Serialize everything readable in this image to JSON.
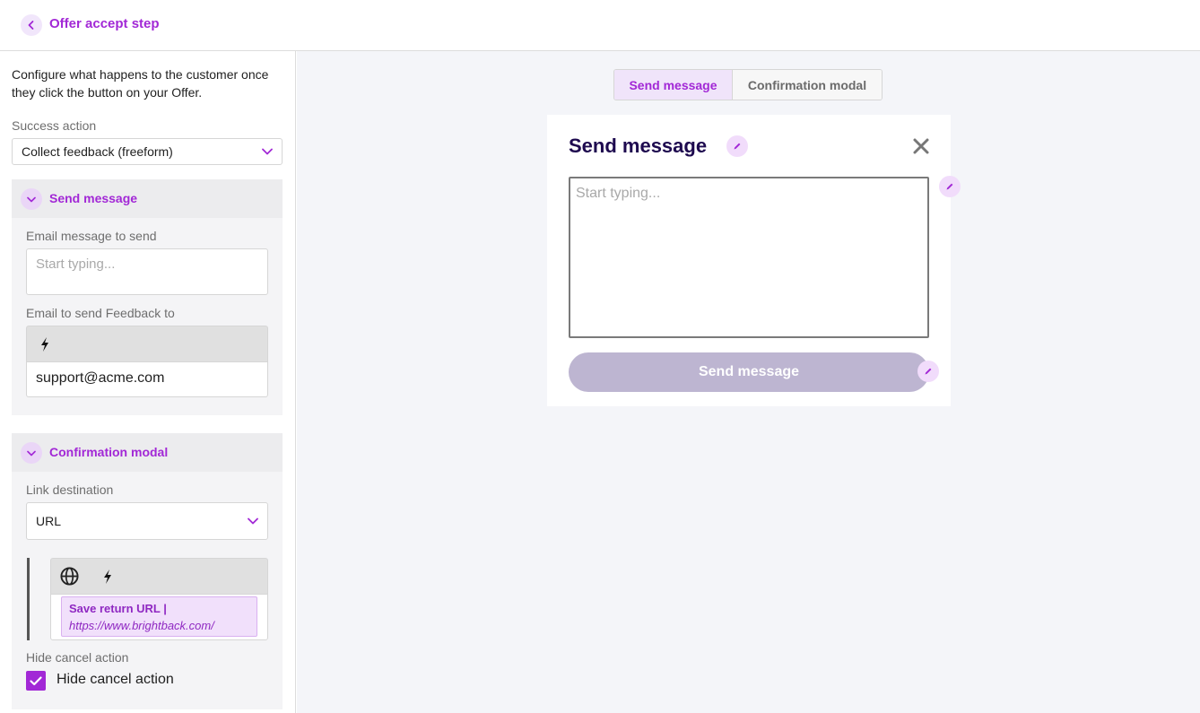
{
  "header": {
    "title": "Offer accept step"
  },
  "left": {
    "intro": "Configure what happens to the customer once they click the button on your Offer.",
    "success_action": {
      "label": "Success action",
      "value": "Collect feedback (freeform)"
    },
    "send_message_section": {
      "title": "Send message",
      "email_message_label": "Email message to send",
      "email_message_placeholder": "Start typing...",
      "feedback_email_label": "Email to send Feedback to",
      "feedback_email_value": "support@acme.com"
    },
    "confirmation_section": {
      "title": "Confirmation modal",
      "link_destination_label": "Link destination",
      "link_destination_value": "URL",
      "save_return_label": "Save return URL |",
      "save_return_value": "https://www.brightback.com/",
      "hide_cancel_label": "Hide cancel action",
      "hide_cancel_checkbox_label": "Hide cancel action",
      "hide_cancel_checked": true
    }
  },
  "preview": {
    "tabs": [
      {
        "label": "Send message",
        "active": true
      },
      {
        "label": "Confirmation modal",
        "active": false
      }
    ],
    "modal": {
      "title": "Send message",
      "textarea_placeholder": "Start typing...",
      "button_label": "Send message"
    }
  },
  "colors": {
    "accent": "#a228d6",
    "modal_title": "#1e0a4f",
    "button_disabled": "#bdb5d1",
    "preview_bg": "#f4f5f9"
  },
  "icons": [
    "chevron-left-icon",
    "chevron-down-icon",
    "lightning-icon",
    "globe-icon",
    "pencil-icon",
    "close-icon",
    "check-icon"
  ]
}
